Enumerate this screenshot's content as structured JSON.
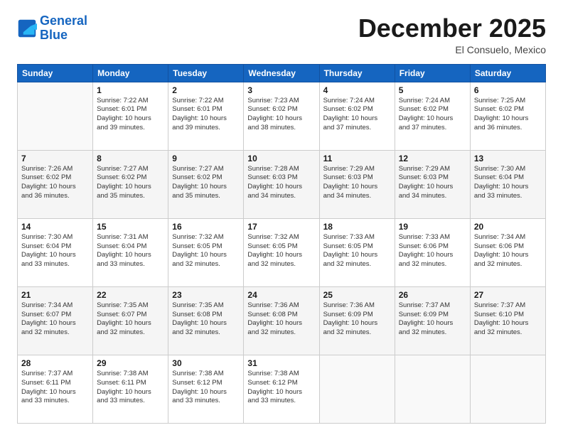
{
  "logo": {
    "line1": "General",
    "line2": "Blue"
  },
  "title": "December 2025",
  "subtitle": "El Consuelo, Mexico",
  "days_header": [
    "Sunday",
    "Monday",
    "Tuesday",
    "Wednesday",
    "Thursday",
    "Friday",
    "Saturday"
  ],
  "weeks": [
    [
      {
        "num": "",
        "info": ""
      },
      {
        "num": "1",
        "info": "Sunrise: 7:22 AM\nSunset: 6:01 PM\nDaylight: 10 hours\nand 39 minutes."
      },
      {
        "num": "2",
        "info": "Sunrise: 7:22 AM\nSunset: 6:01 PM\nDaylight: 10 hours\nand 39 minutes."
      },
      {
        "num": "3",
        "info": "Sunrise: 7:23 AM\nSunset: 6:02 PM\nDaylight: 10 hours\nand 38 minutes."
      },
      {
        "num": "4",
        "info": "Sunrise: 7:24 AM\nSunset: 6:02 PM\nDaylight: 10 hours\nand 37 minutes."
      },
      {
        "num": "5",
        "info": "Sunrise: 7:24 AM\nSunset: 6:02 PM\nDaylight: 10 hours\nand 37 minutes."
      },
      {
        "num": "6",
        "info": "Sunrise: 7:25 AM\nSunset: 6:02 PM\nDaylight: 10 hours\nand 36 minutes."
      }
    ],
    [
      {
        "num": "7",
        "info": "Sunrise: 7:26 AM\nSunset: 6:02 PM\nDaylight: 10 hours\nand 36 minutes."
      },
      {
        "num": "8",
        "info": "Sunrise: 7:27 AM\nSunset: 6:02 PM\nDaylight: 10 hours\nand 35 minutes."
      },
      {
        "num": "9",
        "info": "Sunrise: 7:27 AM\nSunset: 6:02 PM\nDaylight: 10 hours\nand 35 minutes."
      },
      {
        "num": "10",
        "info": "Sunrise: 7:28 AM\nSunset: 6:03 PM\nDaylight: 10 hours\nand 34 minutes."
      },
      {
        "num": "11",
        "info": "Sunrise: 7:29 AM\nSunset: 6:03 PM\nDaylight: 10 hours\nand 34 minutes."
      },
      {
        "num": "12",
        "info": "Sunrise: 7:29 AM\nSunset: 6:03 PM\nDaylight: 10 hours\nand 34 minutes."
      },
      {
        "num": "13",
        "info": "Sunrise: 7:30 AM\nSunset: 6:04 PM\nDaylight: 10 hours\nand 33 minutes."
      }
    ],
    [
      {
        "num": "14",
        "info": "Sunrise: 7:30 AM\nSunset: 6:04 PM\nDaylight: 10 hours\nand 33 minutes."
      },
      {
        "num": "15",
        "info": "Sunrise: 7:31 AM\nSunset: 6:04 PM\nDaylight: 10 hours\nand 33 minutes."
      },
      {
        "num": "16",
        "info": "Sunrise: 7:32 AM\nSunset: 6:05 PM\nDaylight: 10 hours\nand 32 minutes."
      },
      {
        "num": "17",
        "info": "Sunrise: 7:32 AM\nSunset: 6:05 PM\nDaylight: 10 hours\nand 32 minutes."
      },
      {
        "num": "18",
        "info": "Sunrise: 7:33 AM\nSunset: 6:05 PM\nDaylight: 10 hours\nand 32 minutes."
      },
      {
        "num": "19",
        "info": "Sunrise: 7:33 AM\nSunset: 6:06 PM\nDaylight: 10 hours\nand 32 minutes."
      },
      {
        "num": "20",
        "info": "Sunrise: 7:34 AM\nSunset: 6:06 PM\nDaylight: 10 hours\nand 32 minutes."
      }
    ],
    [
      {
        "num": "21",
        "info": "Sunrise: 7:34 AM\nSunset: 6:07 PM\nDaylight: 10 hours\nand 32 minutes."
      },
      {
        "num": "22",
        "info": "Sunrise: 7:35 AM\nSunset: 6:07 PM\nDaylight: 10 hours\nand 32 minutes."
      },
      {
        "num": "23",
        "info": "Sunrise: 7:35 AM\nSunset: 6:08 PM\nDaylight: 10 hours\nand 32 minutes."
      },
      {
        "num": "24",
        "info": "Sunrise: 7:36 AM\nSunset: 6:08 PM\nDaylight: 10 hours\nand 32 minutes."
      },
      {
        "num": "25",
        "info": "Sunrise: 7:36 AM\nSunset: 6:09 PM\nDaylight: 10 hours\nand 32 minutes."
      },
      {
        "num": "26",
        "info": "Sunrise: 7:37 AM\nSunset: 6:09 PM\nDaylight: 10 hours\nand 32 minutes."
      },
      {
        "num": "27",
        "info": "Sunrise: 7:37 AM\nSunset: 6:10 PM\nDaylight: 10 hours\nand 32 minutes."
      }
    ],
    [
      {
        "num": "28",
        "info": "Sunrise: 7:37 AM\nSunset: 6:11 PM\nDaylight: 10 hours\nand 33 minutes."
      },
      {
        "num": "29",
        "info": "Sunrise: 7:38 AM\nSunset: 6:11 PM\nDaylight: 10 hours\nand 33 minutes."
      },
      {
        "num": "30",
        "info": "Sunrise: 7:38 AM\nSunset: 6:12 PM\nDaylight: 10 hours\nand 33 minutes."
      },
      {
        "num": "31",
        "info": "Sunrise: 7:38 AM\nSunset: 6:12 PM\nDaylight: 10 hours\nand 33 minutes."
      },
      {
        "num": "",
        "info": ""
      },
      {
        "num": "",
        "info": ""
      },
      {
        "num": "",
        "info": ""
      }
    ]
  ]
}
